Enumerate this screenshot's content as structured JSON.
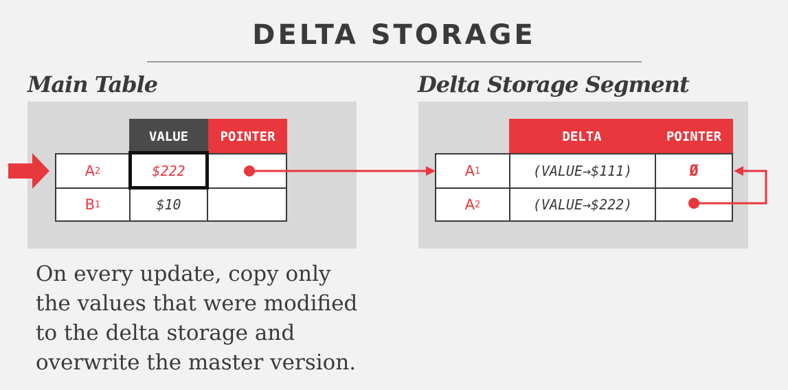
{
  "title": "DELTA STORAGE",
  "main_table": {
    "label": "Main Table",
    "headers": [
      "VALUE",
      "POINTER"
    ],
    "rows": [
      {
        "name": "A",
        "sub": "2",
        "value": "$222"
      },
      {
        "name": "B",
        "sub": "1",
        "value": "$10"
      }
    ]
  },
  "delta_segment": {
    "label": "Delta Storage Segment",
    "headers": [
      "DELTA",
      "POINTER"
    ],
    "rows": [
      {
        "name": "A",
        "sub": "1",
        "delta": "(VALUE→$111)",
        "pointer": "Ø"
      },
      {
        "name": "A",
        "sub": "2",
        "delta": "(VALUE→$222)",
        "pointer": ""
      }
    ]
  },
  "caption": [
    "On every update, copy only",
    "the values that were modified",
    "to the delta storage and",
    "overwrite the master version."
  ],
  "colors": {
    "accent": "#e8373d",
    "dark": "#3a3a3a",
    "panel": "#d8d8d8"
  }
}
